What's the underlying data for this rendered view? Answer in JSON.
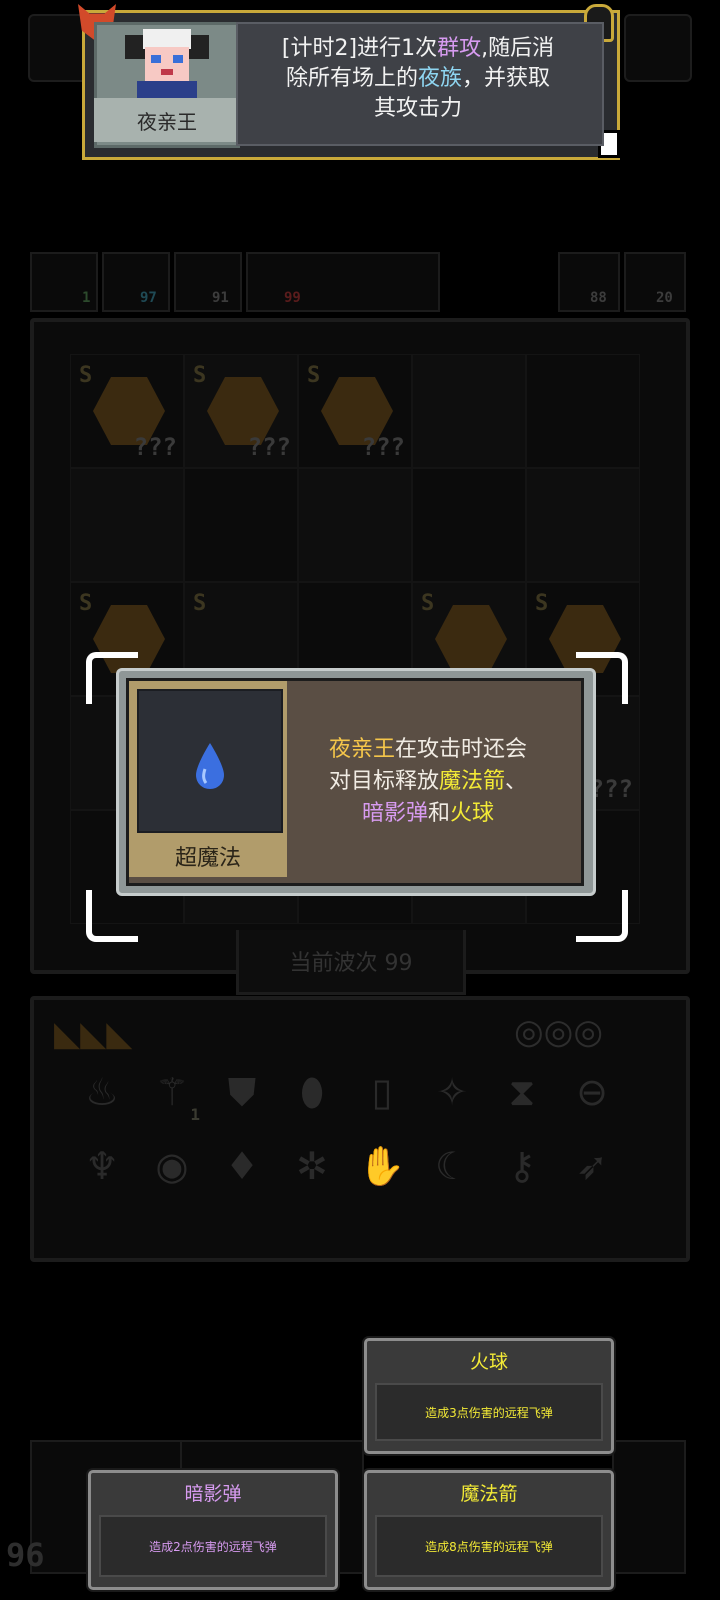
{
  "colors": {
    "gold_border": "#c9a93a",
    "highlight_gold": "#f5c64a",
    "highlight_purple": "#d79bf0",
    "highlight_cyan": "#8fd6f2",
    "highlight_yellow": "#f3ea36"
  },
  "tooltip": {
    "unit_name": "夜亲王",
    "desc_line1_a": "[计时2]进行1次",
    "desc_line1_b": "群攻",
    "desc_line1_c": ",随后消",
    "desc_line2_a": "除所有场上的",
    "desc_line2_b": "夜族",
    "desc_line2_c": "，并获取",
    "desc_line3": "其攻击力",
    "portrait_icon": "vampire-lord-portrait",
    "corner_icon_left": "demon-head-icon",
    "corner_icon_right": "lock-icon"
  },
  "stats": {
    "s1": "1",
    "s2": "97",
    "s3": "91",
    "s4": "99",
    "s5": "88",
    "s6": "20",
    "bottom_left_number": "96"
  },
  "board": {
    "unknown_label": "???",
    "rarity_label": "S",
    "wave_label": "当前波次 99"
  },
  "popup": {
    "item_name": "超魔法",
    "item_icon": "water-drop-icon",
    "desc1_a": "夜亲王",
    "desc1_b": "在攻击时还会",
    "desc2_a": "对目标释放",
    "desc2_b": "魔法箭",
    "desc2_c": "、",
    "desc3_a": "暗影弹",
    "desc3_b": "和",
    "desc3_c": "火球"
  },
  "cards": {
    "fireball": {
      "title": "火球",
      "desc": "造成3点伤害的远程飞弹",
      "color": "#f3ea36"
    },
    "shadow": {
      "title": "暗影弹",
      "desc": "造成2点伤害的远程飞弹",
      "color": "#d79bf0"
    },
    "arrow": {
      "title": "魔法箭",
      "desc": "造成8点伤害的远程飞弹",
      "color": "#f3ea36"
    }
  }
}
